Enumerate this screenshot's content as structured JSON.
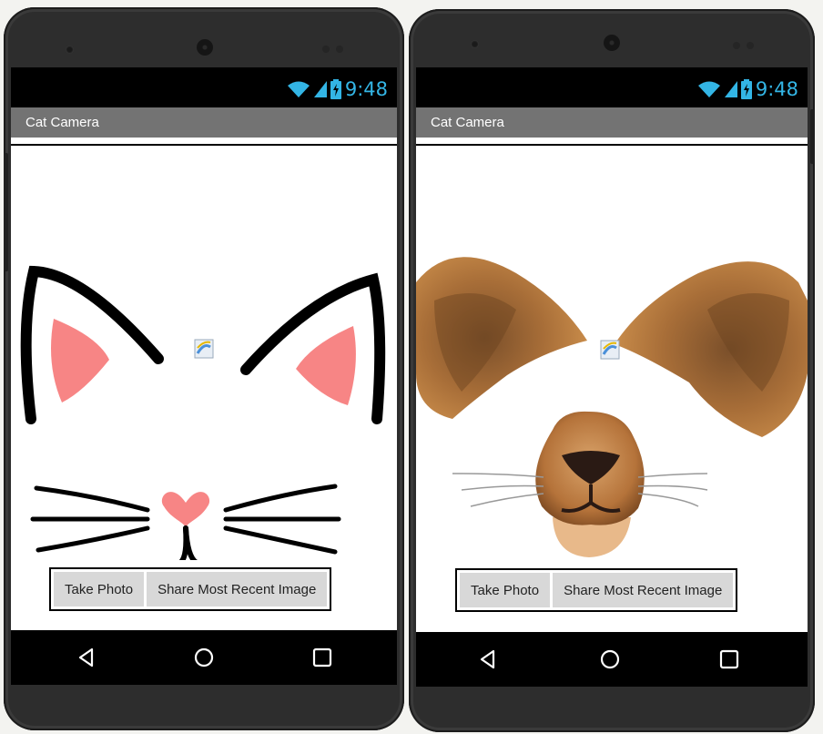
{
  "screens": [
    {
      "app_title": "Cat Camera",
      "clock": "9:48",
      "take_photo_label": "Take Photo",
      "share_label": "Share Most Recent Image",
      "filter": "cat-face"
    },
    {
      "app_title": "Cat Camera",
      "clock": "9:48",
      "take_photo_label": "Take Photo",
      "share_label": "Share Most Recent Image",
      "filter": "lion-face"
    }
  ],
  "colors": {
    "clock_blue": "#33b5e5",
    "title_bar_gray": "#737373",
    "cat_pink": "#f78585",
    "lion_brown": "#c9843f"
  }
}
